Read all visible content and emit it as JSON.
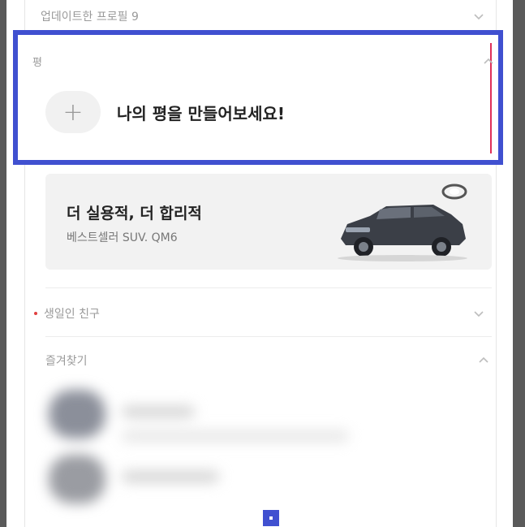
{
  "sections": {
    "updated_profiles": {
      "label": "업데이트한 프로필 9"
    },
    "pyeong": {
      "label": "평",
      "add_label": "+",
      "add_text": "나의 평을 만들어보세요!"
    },
    "ad": {
      "title": "더 실용적, 더 합리적",
      "subtitle": "베스트셀러 SUV. QM6",
      "image": "car-image",
      "logo": "renault-logo"
    },
    "birthday_friends": {
      "label": "생일인 친구"
    },
    "favorites": {
      "label": "즐겨찾기"
    }
  },
  "icons": {
    "chevron_down": "chevron-down-icon",
    "chevron_up": "chevron-up-icon",
    "plus": "plus-icon"
  },
  "colors": {
    "highlight": "#4050d0",
    "accent_red": "#e04040",
    "text_primary": "#222222",
    "text_muted": "#9a9a9a"
  }
}
